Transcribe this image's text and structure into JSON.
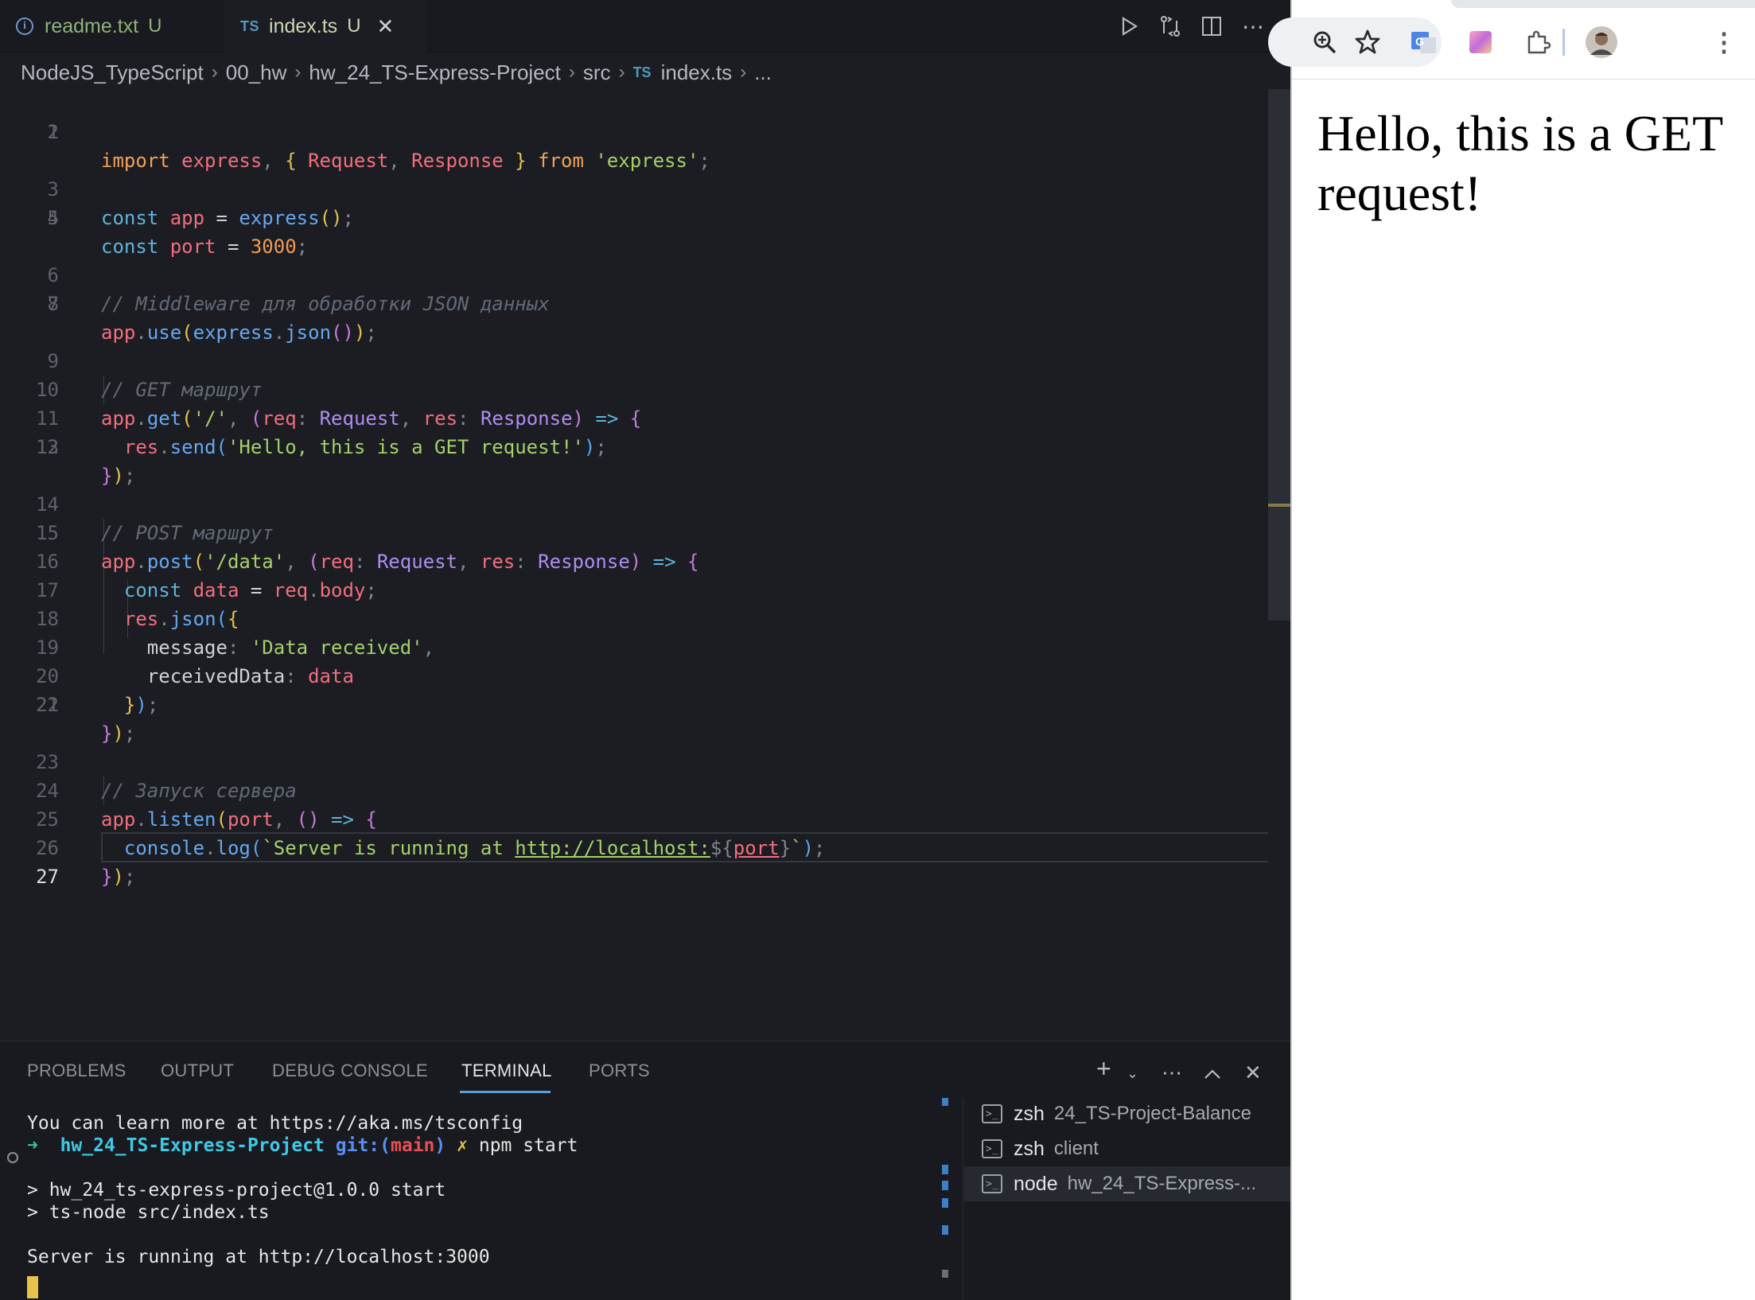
{
  "editor_tabs": [
    {
      "label": "readme.txt",
      "status": "U",
      "icon": "info-icon"
    },
    {
      "label": "index.ts",
      "status": "U",
      "icon": "typescript-icon",
      "badge": "TS",
      "active": true
    }
  ],
  "breadcrumb": {
    "items": [
      "NodeJS_TypeScript",
      "00_hw",
      "hw_24_TS-Express-Project",
      "src"
    ],
    "file_badge": "TS",
    "file": "index.ts",
    "ellipsis": "..."
  },
  "editor": {
    "current_line": 27,
    "lines": [
      {
        "n": "1"
      },
      {
        "n": "2"
      },
      {
        "n": "3"
      },
      {
        "n": "4"
      },
      {
        "n": "5"
      },
      {
        "n": "6"
      },
      {
        "n": "7"
      },
      {
        "n": "8"
      },
      {
        "n": "9"
      },
      {
        "n": "10"
      },
      {
        "n": "11"
      },
      {
        "n": "12"
      },
      {
        "n": "13"
      },
      {
        "n": "14"
      },
      {
        "n": "15"
      },
      {
        "n": "16"
      },
      {
        "n": "17"
      },
      {
        "n": "18"
      },
      {
        "n": "19"
      },
      {
        "n": "20"
      },
      {
        "n": "21"
      },
      {
        "n": "22"
      },
      {
        "n": "23"
      },
      {
        "n": "24"
      },
      {
        "n": "25"
      },
      {
        "n": "26"
      },
      {
        "n": "27"
      }
    ],
    "code": {
      "l1": [
        "import",
        " express",
        ", ",
        "{",
        " Request",
        ", ",
        "Response",
        " ",
        "}",
        " from ",
        "'express'",
        ";"
      ],
      "l3": [
        "const",
        " app",
        " = ",
        "express",
        "(",
        ")",
        ";"
      ],
      "l4": [
        "const",
        " port",
        " = ",
        "3000",
        ";"
      ],
      "l6": [
        "// Middleware для обработки JSON данных"
      ],
      "l7": [
        "app",
        ".",
        "use",
        "(",
        "express",
        ".",
        "json",
        "(",
        ")",
        ")",
        ";"
      ],
      "l9": [
        "// GET маршрут"
      ],
      "l10": [
        "app",
        ".",
        "get",
        "(",
        "'/'",
        ", ",
        "(",
        "req",
        ": ",
        "Request",
        ", ",
        "res",
        ": ",
        "Response",
        ")",
        " => ",
        "{"
      ],
      "l11": [
        "  ",
        "res",
        ".",
        "send",
        "(",
        "'Hello, this is a GET request!'",
        ")",
        ";"
      ],
      "l12": [
        "}",
        ")",
        ";"
      ],
      "l14": [
        "// POST маршрут"
      ],
      "l15": [
        "app",
        ".",
        "post",
        "(",
        "'/data'",
        ", ",
        "(",
        "req",
        ": ",
        "Request",
        ", ",
        "res",
        ": ",
        "Response",
        ")",
        " => ",
        "{"
      ],
      "l16": [
        "  ",
        "const",
        " data",
        " = ",
        "req",
        ".",
        "body",
        ";"
      ],
      "l17": [
        "  ",
        "res",
        ".",
        "json",
        "(",
        "{"
      ],
      "l18": [
        "    ",
        "message",
        ": ",
        "'Data received'",
        ","
      ],
      "l19": [
        "    ",
        "receivedData",
        ": ",
        "data"
      ],
      "l20": [
        "  ",
        "}",
        ")",
        ";"
      ],
      "l21": [
        "}",
        ")",
        ";"
      ],
      "l23": [
        "// Запуск сервера"
      ],
      "l24": [
        "app",
        ".",
        "listen",
        "(",
        "port",
        ", ",
        "(",
        ")",
        " => ",
        "{"
      ],
      "l25": [
        "  ",
        "console",
        ".",
        "log",
        "(",
        "`Server is running at ",
        "http://localhost:",
        "${",
        "port",
        "}",
        "`",
        ")",
        ";"
      ],
      "l26": [
        "}",
        ")",
        ";"
      ]
    }
  },
  "panel": {
    "tabs": [
      "PROBLEMS",
      "OUTPUT",
      "DEBUG CONSOLE",
      "TERMINAL",
      "PORTS"
    ],
    "active_tab": "TERMINAL"
  },
  "terminal": {
    "lines": {
      "l1": "You can learn more at https://aka.ms/tsconfig",
      "prompt_arrow": "➜",
      "prompt_dir": "hw_24_TS-Express-Project",
      "prompt_git": "git:(",
      "prompt_branch": "main",
      "prompt_git_close": ")",
      "prompt_x": "✗",
      "prompt_cmd": "npm start",
      "l3": "> hw_24_ts-express-project@1.0.0 start",
      "l4": "> ts-node src/index.ts",
      "l5": "Server is running at http://localhost:3000"
    },
    "sessions": [
      {
        "name": "zsh",
        "desc": "24_TS-Project-Balance"
      },
      {
        "name": "zsh",
        "desc": "client"
      },
      {
        "name": "node",
        "desc": "hw_24_TS-Express-...",
        "active": true
      }
    ]
  },
  "browser": {
    "page_text": "Hello, this is a GET request!"
  },
  "colors": {
    "editor_bg": "#1b1d23",
    "panel_bg": "#181a1f",
    "accent_blue": "#5f9bd8",
    "untracked_green": "#8fb27a"
  }
}
